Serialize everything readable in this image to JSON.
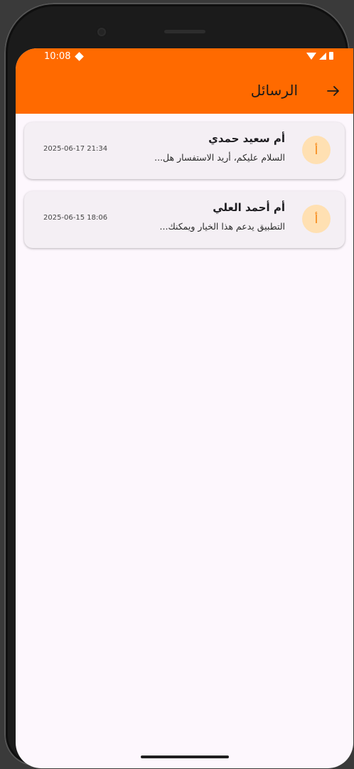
{
  "status_bar": {
    "time": "10:08"
  },
  "app_bar": {
    "title": "الرسائل",
    "back_icon": "arrow-right-icon",
    "color": "#ff6a00"
  },
  "messages": [
    {
      "avatar_letter": "أ",
      "sender": "أم سعيد حمدي",
      "preview": "السلام عليكم، أريد الاستفسار هل...",
      "timestamp": "2025-06-17 21:34"
    },
    {
      "avatar_letter": "أ",
      "sender": "أم أحمد العلي",
      "preview": "التطبيق يدعم هذا الخيار ويمكنك...",
      "timestamp": "2025-06-15 18:06"
    }
  ],
  "colors": {
    "avatar_bg": "#ffe0b2",
    "avatar_fg": "#f57c00",
    "screen_bg": "#fdf7fd",
    "card_bg": "#f4eff4"
  }
}
